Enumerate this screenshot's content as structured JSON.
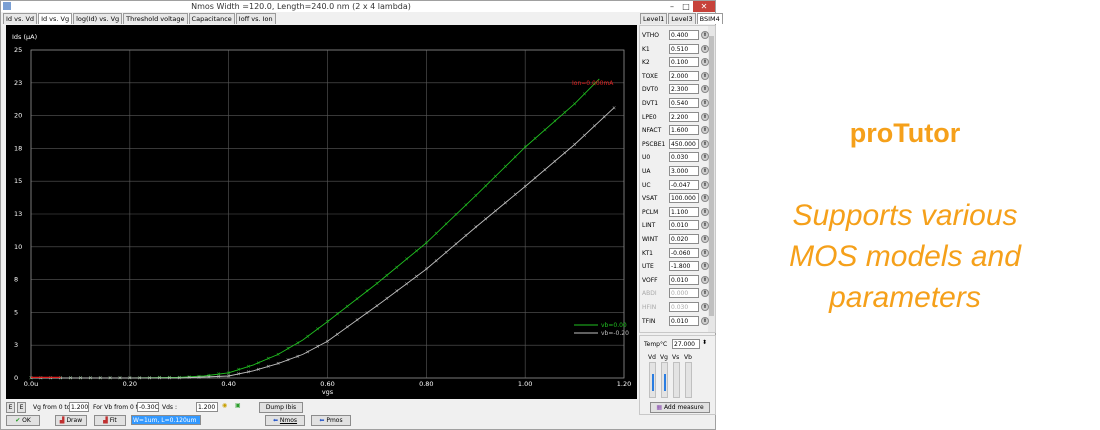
{
  "window": {
    "title": "Nmos Width =120.0, Length=240.0 nm (2 x 4 lambda)",
    "minimize": "–",
    "maximize": "□",
    "close": "✕"
  },
  "tabs": [
    "Id vs. Vd",
    "Id vs. Vg",
    "log(Id) vs. Vg",
    "Threshold voltage",
    "Capacitance",
    "Ioff vs. Ion"
  ],
  "right_tabs": [
    "Level1",
    "Level3",
    "BSIM4"
  ],
  "params": [
    {
      "name": "VTHO",
      "value": "0.400"
    },
    {
      "name": "K1",
      "value": "0.510"
    },
    {
      "name": "K2",
      "value": "0.100"
    },
    {
      "name": "TOXE",
      "value": "2.000"
    },
    {
      "name": "DVT0",
      "value": "2.300"
    },
    {
      "name": "DVT1",
      "value": "0.540"
    },
    {
      "name": "LPE0",
      "value": "2.200"
    },
    {
      "name": "NFACT",
      "value": "1.600"
    },
    {
      "name": "PSCBE1",
      "value": "450.000"
    },
    {
      "name": "U0",
      "value": "0.030"
    },
    {
      "name": "UA",
      "value": "3.000"
    },
    {
      "name": "UC",
      "value": "-0.047"
    },
    {
      "name": "VSAT",
      "value": "100.000"
    },
    {
      "name": "PCLM",
      "value": "1.100"
    },
    {
      "name": "LINT",
      "value": "0.010"
    },
    {
      "name": "WINT",
      "value": "0.020"
    },
    {
      "name": "KT1",
      "value": "-0.060"
    },
    {
      "name": "UTE",
      "value": "-1.800"
    },
    {
      "name": "VOFF",
      "value": "0.010"
    },
    {
      "name": "ABDI",
      "value": "0.000",
      "disabled": true
    },
    {
      "name": "HFIN",
      "value": "0.030",
      "disabled": true
    },
    {
      "name": "TFIN",
      "value": "0.010"
    }
  ],
  "temp": {
    "label": "Temp°C",
    "value": "27.000"
  },
  "meters": {
    "labels": [
      "Vd",
      "Vg",
      "Vs",
      "Vb"
    ],
    "levels": [
      0.55,
      0.55,
      0.0,
      0.0
    ]
  },
  "add_measure": "Add measure",
  "bottom": {
    "e1": "E",
    "e2": "E",
    "vg_label": "Vg from 0 to",
    "vg_value": "1.200",
    "vb_label": "For Vb from 0 to:",
    "vb_value": "-0.30C",
    "vds_label": "Vds :",
    "vds_value": "1.200",
    "dump": "Dump Ibis",
    "ok": "OK",
    "draw": "Draw",
    "fit": "Fit",
    "select": "W=1um, L=0.120um",
    "nmos": "Nmos",
    "pmos": "Pmos"
  },
  "promo": {
    "title": "proTutor",
    "lines": [
      "Supports various",
      "MOS models and",
      "parameters"
    ]
  },
  "colors": {
    "series1": "#21c021",
    "series2": "#bfbfbf",
    "marker": "#e02020",
    "accent": "#f5a01a"
  },
  "chart_data": {
    "type": "line",
    "title": "",
    "xlabel": "vgs",
    "ylabel": "Ids (µA)",
    "xlim": [
      0,
      1.2
    ],
    "ylim": [
      0,
      25
    ],
    "x_ticks": [
      "0.0u",
      "0.20",
      "0.40",
      "0.60",
      "0.80",
      "1.00",
      "1.20"
    ],
    "y_ticks": [
      "0",
      "3",
      "5",
      "8",
      "10",
      "13",
      "15",
      "18",
      "20",
      "23",
      "25"
    ],
    "y_tick_values": [
      0,
      2.5,
      5,
      7.5,
      10,
      12.5,
      15,
      17.5,
      20,
      22.5,
      25
    ],
    "grid": true,
    "legend_position": "bottom-right",
    "annotation": "Ion=0.000mA",
    "series": [
      {
        "name": "vb=0.00",
        "x": [
          0,
          0.2,
          0.3,
          0.35,
          0.4,
          0.45,
          0.5,
          0.55,
          0.6,
          0.7,
          0.8,
          0.9,
          1.0,
          1.1,
          1.15
        ],
        "values": [
          0,
          0,
          0.05,
          0.15,
          0.4,
          1.0,
          1.8,
          2.9,
          4.3,
          7.2,
          10.3,
          13.9,
          17.6,
          20.9,
          22.8
        ]
      },
      {
        "name": "vb=-0.20",
        "x": [
          0,
          0.2,
          0.3,
          0.4,
          0.45,
          0.5,
          0.55,
          0.6,
          0.7,
          0.8,
          0.9,
          1.0,
          1.1,
          1.18
        ],
        "values": [
          0,
          0,
          0,
          0.15,
          0.55,
          1.1,
          1.8,
          2.8,
          5.5,
          8.3,
          11.5,
          14.6,
          17.8,
          20.6
        ]
      }
    ]
  }
}
